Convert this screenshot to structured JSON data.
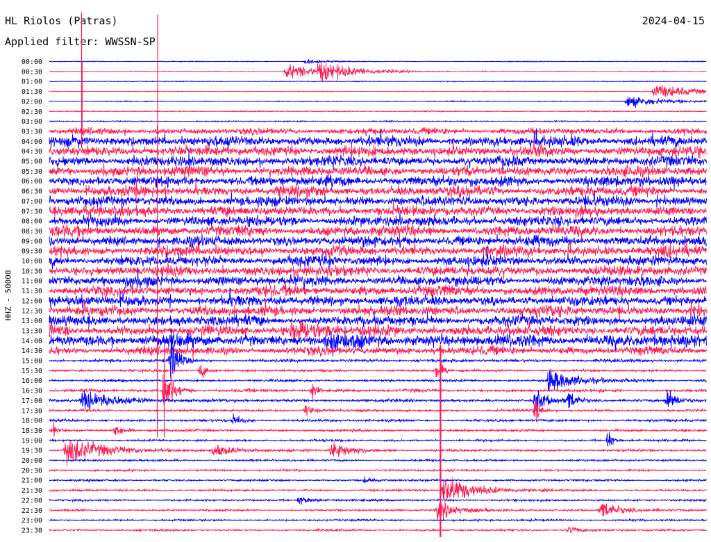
{
  "header": {
    "title": "HL Riolos (Patras)",
    "filter": "Applied filter: WWSSN-SP",
    "date": "2024-04-15",
    "axis_label": "HHZ - 50000"
  },
  "colors": {
    "blue": "#0000ff",
    "red": "#ff1a4f",
    "background": "#ffffff",
    "text": "#000000"
  },
  "chart_data": {
    "type": "line",
    "title": "HL Riolos (Patras)",
    "subtitle": "Applied filter: WWSSN-SP",
    "date": "2024-04-15",
    "ylabel": "HHZ - 50000",
    "row_labels": [
      "00:00",
      "00:30",
      "01:00",
      "01:30",
      "02:00",
      "02:30",
      "03:00",
      "03:30",
      "04:00",
      "04:30",
      "05:00",
      "05:30",
      "06:00",
      "06:30",
      "07:00",
      "07:30",
      "08:00",
      "08:30",
      "09:00",
      "09:30",
      "10:00",
      "10:30",
      "11:00",
      "11:30",
      "12:00",
      "12:30",
      "13:00",
      "13:30",
      "14:00",
      "14:30",
      "15:00",
      "15:30",
      "16:00",
      "16:30",
      "17:00",
      "17:30",
      "18:00",
      "18:30",
      "19:00",
      "19:30",
      "20:00",
      "20:30",
      "21:00",
      "21:30",
      "22:00",
      "22:30",
      "23:00",
      "23:30"
    ],
    "row_colors": [
      "blue",
      "red"
    ],
    "noise_level": [
      0.4,
      0.4,
      0.4,
      0.4,
      0.5,
      0.5,
      0.6,
      3,
      5,
      5,
      5,
      5,
      5,
      5,
      5,
      5,
      5,
      5,
      5,
      5,
      5,
      5,
      5,
      5,
      5,
      5,
      5,
      5,
      6,
      4,
      1.5,
      1.2,
      1.2,
      1.5,
      1.5,
      1.2,
      1.2,
      1.2,
      1.0,
      1.2,
      1.0,
      1.0,
      1.0,
      1.0,
      1.0,
      1.0,
      1.0,
      1.0
    ],
    "events": [
      {
        "row": 0,
        "x": 0.39,
        "amp": 3,
        "dur": 0.02
      },
      {
        "row": 1,
        "x": 0.36,
        "amp": 9,
        "dur": 0.05
      },
      {
        "row": 1,
        "x": 0.41,
        "amp": 10,
        "dur": 0.05
      },
      {
        "row": 3,
        "x": 0.92,
        "amp": 9,
        "dur": 0.06
      },
      {
        "row": 4,
        "x": 0.88,
        "amp": 7,
        "dur": 0.05
      },
      {
        "row": 7,
        "x": 0.05,
        "amp": 100,
        "dur": 0.004,
        "spike": true
      },
      {
        "row": 7,
        "x": 0.165,
        "amp": 168,
        "dur": 0.004,
        "spike": true
      },
      {
        "row": 27,
        "x": 0.37,
        "amp": 15,
        "dur": 0.03
      },
      {
        "row": 28,
        "x": 0.42,
        "amp": 10,
        "dur": 0.03
      },
      {
        "row": 30,
        "x": 0.185,
        "amp": 30,
        "dur": 0.01
      },
      {
        "row": 31,
        "x": 0.23,
        "amp": 12,
        "dur": 0.008
      },
      {
        "row": 31,
        "x": 0.59,
        "amp": 14,
        "dur": 0.008
      },
      {
        "row": 32,
        "x": 0.76,
        "amp": 14,
        "dur": 0.04
      },
      {
        "row": 33,
        "x": 0.175,
        "amp": 35,
        "dur": 0.012
      },
      {
        "row": 33,
        "x": 0.4,
        "amp": 12,
        "dur": 0.006
      },
      {
        "row": 34,
        "x": 0.05,
        "amp": 12,
        "dur": 0.05
      },
      {
        "row": 34,
        "x": 0.74,
        "amp": 14,
        "dur": 0.015
      },
      {
        "row": 34,
        "x": 0.79,
        "amp": 12,
        "dur": 0.012
      },
      {
        "row": 34,
        "x": 0.94,
        "amp": 14,
        "dur": 0.015
      },
      {
        "row": 35,
        "x": 0.74,
        "amp": 18,
        "dur": 0.006
      },
      {
        "row": 35,
        "x": 0.39,
        "amp": 8,
        "dur": 0.01
      },
      {
        "row": 36,
        "x": 0.28,
        "amp": 8,
        "dur": 0.01
      },
      {
        "row": 37,
        "x": 0.1,
        "amp": 10,
        "dur": 0.01
      },
      {
        "row": 37,
        "x": 0.005,
        "amp": 8,
        "dur": 0.008
      },
      {
        "row": 38,
        "x": 0.85,
        "amp": 14,
        "dur": 0.006
      },
      {
        "row": 39,
        "x": 0.025,
        "amp": 18,
        "dur": 0.05
      },
      {
        "row": 39,
        "x": 0.25,
        "amp": 8,
        "dur": 0.03
      },
      {
        "row": 39,
        "x": 0.43,
        "amp": 12,
        "dur": 0.025
      },
      {
        "row": 42,
        "x": 0.48,
        "amp": 4,
        "dur": 0.01
      },
      {
        "row": 43,
        "x": 0.6,
        "amp": 20,
        "dur": 0.04
      },
      {
        "row": 44,
        "x": 0.38,
        "amp": 5,
        "dur": 0.02
      },
      {
        "row": 45,
        "x": 0.59,
        "amp": 12,
        "dur": 0.03
      },
      {
        "row": 45,
        "x": 0.84,
        "amp": 12,
        "dur": 0.025
      },
      {
        "row": 47,
        "x": 0.79,
        "amp": 4,
        "dur": 0.02
      }
    ],
    "vertical_spikes": [
      {
        "x": 0.1645,
        "from_row": 7,
        "to_row": 37
      },
      {
        "x": 0.0492,
        "from_row": 0,
        "to_row": 8
      },
      {
        "x": 0.175,
        "from_row": 29,
        "to_row": 37
      },
      {
        "x": 0.5955,
        "from_row": 29,
        "to_row": 47
      }
    ]
  }
}
